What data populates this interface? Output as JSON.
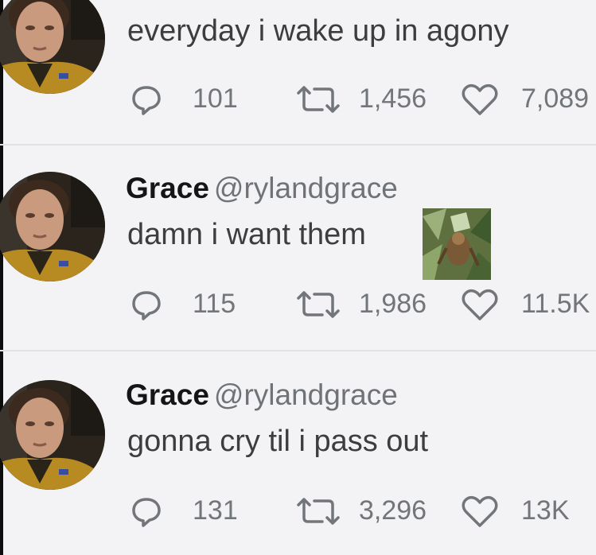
{
  "tweets": [
    {
      "text": "everyday i wake up in agony",
      "replies": "101",
      "retweets": "1,456",
      "likes": "7,089"
    },
    {
      "name": "Grace",
      "handle": "@rylandgrace",
      "text": "damn i want them",
      "replies": "115",
      "retweets": "1,986",
      "likes": "11.5K"
    },
    {
      "name": "Grace",
      "handle": "@rylandgrace",
      "text": "gonna cry til i pass out",
      "replies": "131",
      "retweets": "3,296",
      "likes": "13K"
    }
  ],
  "icons": {
    "reply": "speech-bubble-icon",
    "retweet": "retweet-arrows-icon",
    "like": "heart-icon"
  },
  "colors": {
    "background": "#f3f3f5",
    "name": "#151515",
    "handle": "#6f7378",
    "text": "#3d3d40",
    "icon": "#727579",
    "avatar_jacket": "#b88a22"
  }
}
